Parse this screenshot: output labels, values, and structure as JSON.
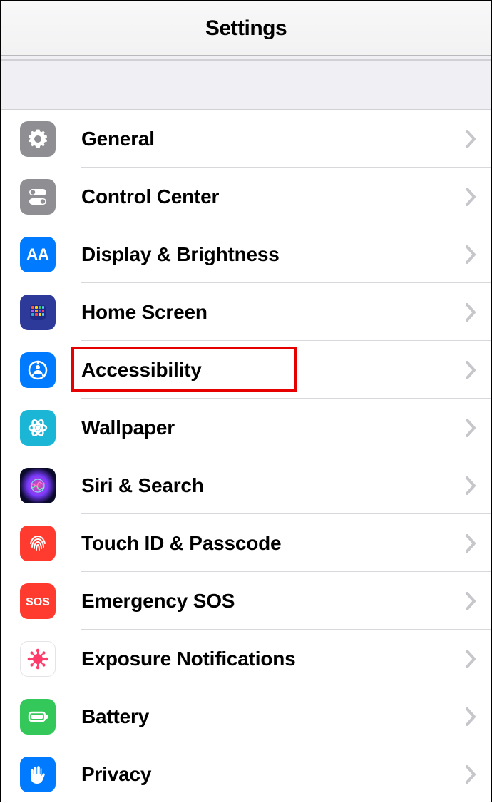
{
  "nav": {
    "title": "Settings"
  },
  "highlight_id": "accessibility",
  "rows": [
    {
      "id": "general",
      "label": "General",
      "icon": "gear",
      "bg": "bg-gray"
    },
    {
      "id": "controlcenter",
      "label": "Control Center",
      "icon": "toggles",
      "bg": "bg-gray"
    },
    {
      "id": "display",
      "label": "Display & Brightness",
      "icon": "aa",
      "bg": "bg-blue"
    },
    {
      "id": "homescreen",
      "label": "Home Screen",
      "icon": "apps",
      "bg": "bg-home"
    },
    {
      "id": "accessibility",
      "label": "Accessibility",
      "icon": "person-circle",
      "bg": "bg-blue"
    },
    {
      "id": "wallpaper",
      "label": "Wallpaper",
      "icon": "flower",
      "bg": "bg-teal"
    },
    {
      "id": "siri",
      "label": "Siri & Search",
      "icon": "siri",
      "bg": "bg-siri"
    },
    {
      "id": "touchid",
      "label": "Touch ID & Passcode",
      "icon": "fingerprint",
      "bg": "bg-red"
    },
    {
      "id": "sos",
      "label": "Emergency SOS",
      "icon": "sos-text",
      "bg": "bg-red"
    },
    {
      "id": "exposure",
      "label": "Exposure Notifications",
      "icon": "covid",
      "bg": "bg-white"
    },
    {
      "id": "battery",
      "label": "Battery",
      "icon": "battery",
      "bg": "bg-green"
    },
    {
      "id": "privacy",
      "label": "Privacy",
      "icon": "hand",
      "bg": "bg-blue"
    }
  ]
}
